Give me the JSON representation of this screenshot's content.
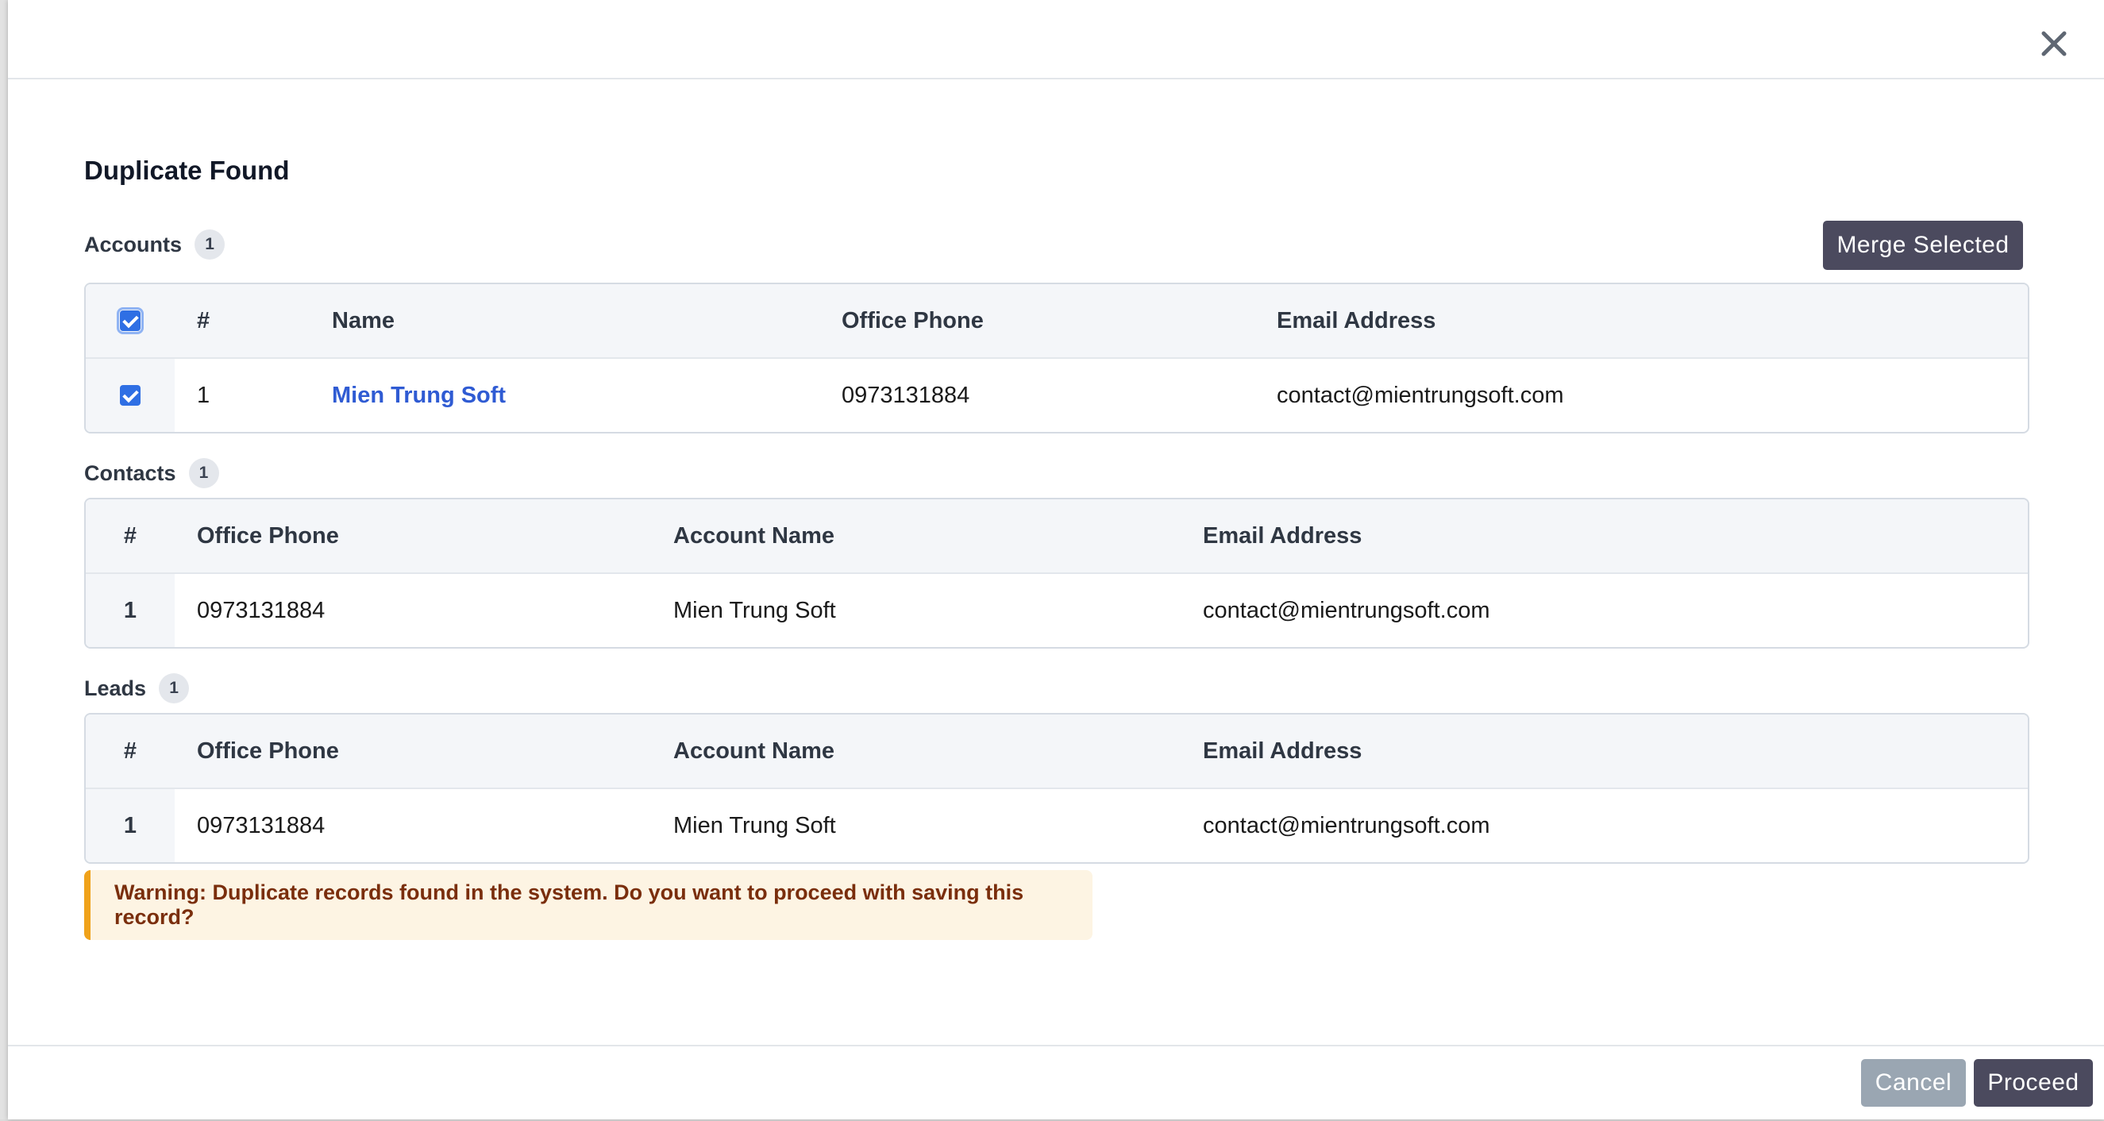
{
  "dialog": {
    "title": "Duplicate Found",
    "close_icon": "close-icon",
    "merge_label": "Merge Selected",
    "cancel_label": "Cancel",
    "proceed_label": "Proceed",
    "warning": "Warning: Duplicate records found in the system. Do you want to proceed with saving this record?"
  },
  "accounts": {
    "label": "Accounts",
    "count": "1",
    "columns": [
      "#",
      "Name",
      "Office Phone",
      "Email Address"
    ],
    "select_all_checked": true,
    "rows": [
      {
        "checked": true,
        "num": "1",
        "name": "Mien Trung Soft",
        "phone": "0973131884",
        "email": "contact@mientrungsoft.com"
      }
    ]
  },
  "contacts": {
    "label": "Contacts",
    "count": "1",
    "columns": [
      "#",
      "Office Phone",
      "Account Name",
      "Email Address"
    ],
    "rows": [
      {
        "num": "1",
        "phone": "0973131884",
        "account": "Mien Trung Soft",
        "email": "contact@mientrungsoft.com"
      }
    ]
  },
  "leads": {
    "label": "Leads",
    "count": "1",
    "columns": [
      "#",
      "Office Phone",
      "Account Name",
      "Email Address"
    ],
    "rows": [
      {
        "num": "1",
        "phone": "0973131884",
        "account": "Mien Trung Soft",
        "email": "contact@mientrungsoft.com"
      }
    ]
  },
  "colors": {
    "primary_button": "#4b4a5e",
    "cancel_button": "#9aa6b2",
    "link": "#2f5bd3",
    "warning_border": "#f0a21a",
    "warning_bg": "#fdf4e3"
  }
}
